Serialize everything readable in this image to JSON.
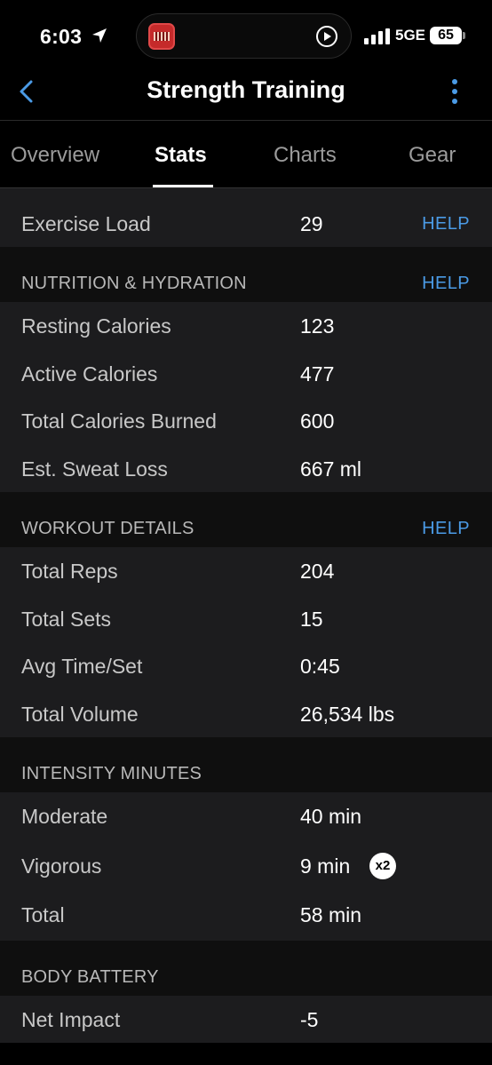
{
  "status": {
    "time": "6:03",
    "network": "5GE",
    "battery": "65"
  },
  "nav": {
    "title": "Strength Training"
  },
  "tabs": [
    {
      "label": "Overview"
    },
    {
      "label": "Stats"
    },
    {
      "label": "Charts"
    },
    {
      "label": "Gear"
    }
  ],
  "exercise_load": {
    "label": "Exercise Load",
    "value": "29",
    "help": "HELP"
  },
  "nutrition": {
    "title": "NUTRITION & HYDRATION",
    "help": "HELP",
    "rows": [
      {
        "label": "Resting Calories",
        "value": "123"
      },
      {
        "label": "Active Calories",
        "value": "477"
      },
      {
        "label": "Total Calories Burned",
        "value": "600"
      },
      {
        "label": "Est. Sweat Loss",
        "value": "667 ml"
      }
    ]
  },
  "workout": {
    "title": "WORKOUT DETAILS",
    "help": "HELP",
    "rows": [
      {
        "label": "Total Reps",
        "value": "204"
      },
      {
        "label": "Total Sets",
        "value": "15"
      },
      {
        "label": "Avg Time/Set",
        "value": "0:45"
      },
      {
        "label": "Total Volume",
        "value": "26,534 lbs"
      }
    ]
  },
  "intensity": {
    "title": "INTENSITY MINUTES",
    "rows": [
      {
        "label": "Moderate",
        "value": "40 min"
      },
      {
        "label": "Vigorous",
        "value": "9 min",
        "badge": "x2"
      },
      {
        "label": "Total",
        "value": "58 min"
      }
    ]
  },
  "body_battery": {
    "title": "BODY BATTERY",
    "rows": [
      {
        "label": "Net Impact",
        "value": "-5"
      }
    ]
  },
  "colors": {
    "accent": "#4b9be6",
    "background": "#000000",
    "row_background": "#1c1c1e"
  },
  "icons": {
    "back": "chevron-left-icon",
    "more": "vertical-ellipsis-icon",
    "location": "location-arrow-icon",
    "play": "play-circle-icon"
  }
}
